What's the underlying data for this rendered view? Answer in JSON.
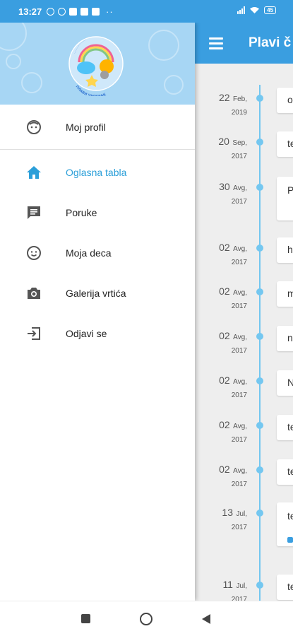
{
  "status_bar": {
    "time": "13:27",
    "battery": "45"
  },
  "app_bar": {
    "title": "Plavi č"
  },
  "header": {
    "logo_arc_text": "ПЛАВИ ЧУПЕРАК"
  },
  "menu": {
    "items": [
      {
        "label": "Moj profil",
        "icon": "face-icon"
      },
      {
        "label": "Oglasna tabla",
        "icon": "home-icon",
        "active": true
      },
      {
        "label": "Poruke",
        "icon": "chat-icon"
      },
      {
        "label": "Moja deca",
        "icon": "child-face-icon"
      },
      {
        "label": "Galerija vrtića",
        "icon": "camera-icon"
      },
      {
        "label": "Odjavi se",
        "icon": "logout-icon"
      }
    ]
  },
  "timeline": [
    {
      "day": "22",
      "month": "Feb,",
      "year": "2019",
      "preview": "o"
    },
    {
      "day": "20",
      "month": "Sep,",
      "year": "2017",
      "preview": "te"
    },
    {
      "day": "30",
      "month": "Avg,",
      "year": "2017",
      "preview": "P"
    },
    {
      "day": "02",
      "month": "Avg,",
      "year": "2017",
      "preview": "h"
    },
    {
      "day": "02",
      "month": "Avg,",
      "year": "2017",
      "preview": "m"
    },
    {
      "day": "02",
      "month": "Avg,",
      "year": "2017",
      "preview": "n"
    },
    {
      "day": "02",
      "month": "Avg,",
      "year": "2017",
      "preview": "N"
    },
    {
      "day": "02",
      "month": "Avg,",
      "year": "2017",
      "preview": "te"
    },
    {
      "day": "02",
      "month": "Avg,",
      "year": "2017",
      "preview": "te"
    },
    {
      "day": "13",
      "month": "Jul,",
      "year": "2017",
      "preview": "te"
    },
    {
      "day": "11",
      "month": "Jul,",
      "year": "2017",
      "preview": "te"
    }
  ],
  "colors": {
    "primary": "#3a9ee0",
    "accent": "#2b9fd9",
    "timeline": "#74c7f0"
  }
}
